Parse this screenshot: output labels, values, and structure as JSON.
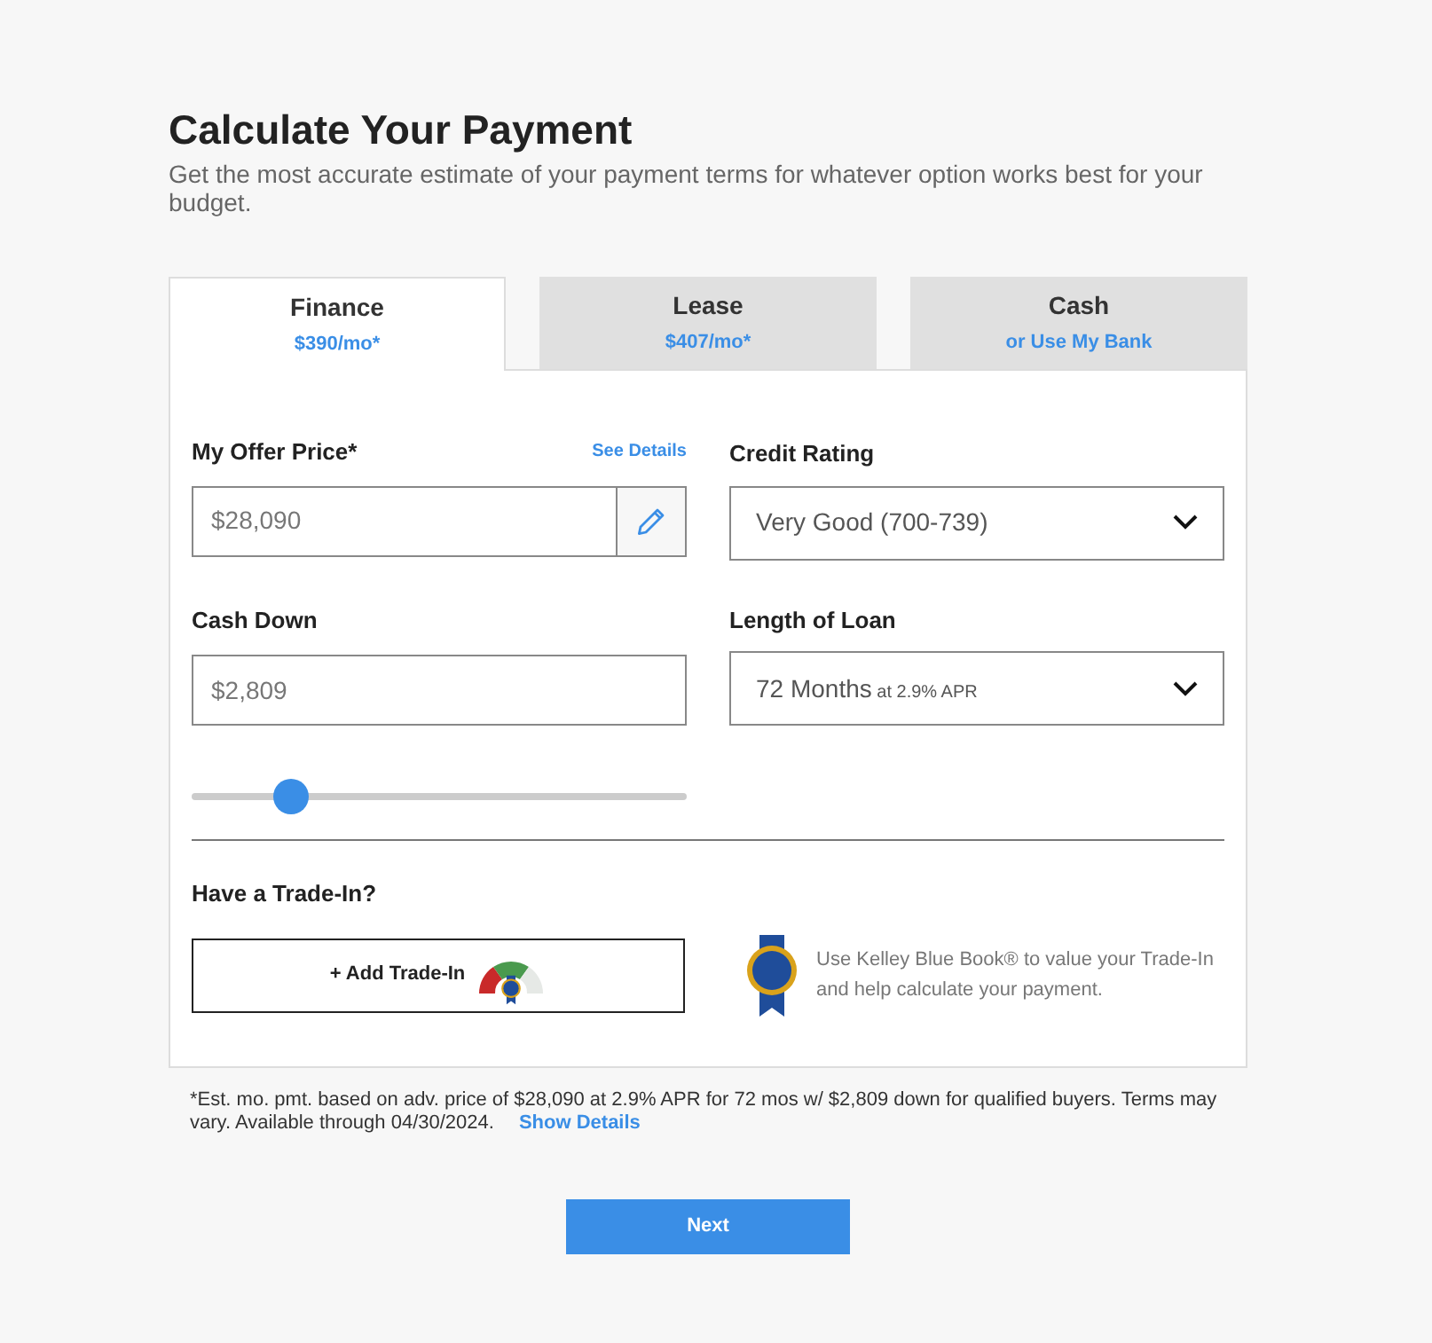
{
  "header": {
    "title": "Calculate Your Payment",
    "subtitle": "Get the most accurate estimate of your payment terms for whatever option works best for your budget."
  },
  "tabs": [
    {
      "label": "Finance",
      "sublabel": "$390/mo*",
      "selected": true
    },
    {
      "label": "Lease",
      "sublabel": "$407/mo*",
      "selected": false
    },
    {
      "label": "Cash",
      "sublabel": "or Use My Bank",
      "selected": false
    }
  ],
  "offer_price": {
    "label": "My Offer Price*",
    "link": "See Details",
    "value": "$28,090"
  },
  "credit_rating": {
    "label": "Credit Rating",
    "value": "Very Good (700-739)"
  },
  "cash_down": {
    "label": "Cash Down",
    "value": "$2,809",
    "level": 0.2
  },
  "loan_length": {
    "label": "Length of Loan",
    "value": "72 Months",
    "note": "at 2.9% APR"
  },
  "trade_in": {
    "heading": "Have a Trade-In?",
    "button": "+ Add Trade-In",
    "info": "Use Kelley Blue Book® to value your Trade-In and help calculate your payment."
  },
  "disclaimer": {
    "text": "*Est. mo. pmt. based on adv. price of $28,090 at 2.9% APR for 72 mos w/ $2,809 down for qualified buyers. Terms may vary. Available through 04/30/2024.",
    "link": "Show Details"
  },
  "next_button": "Next"
}
